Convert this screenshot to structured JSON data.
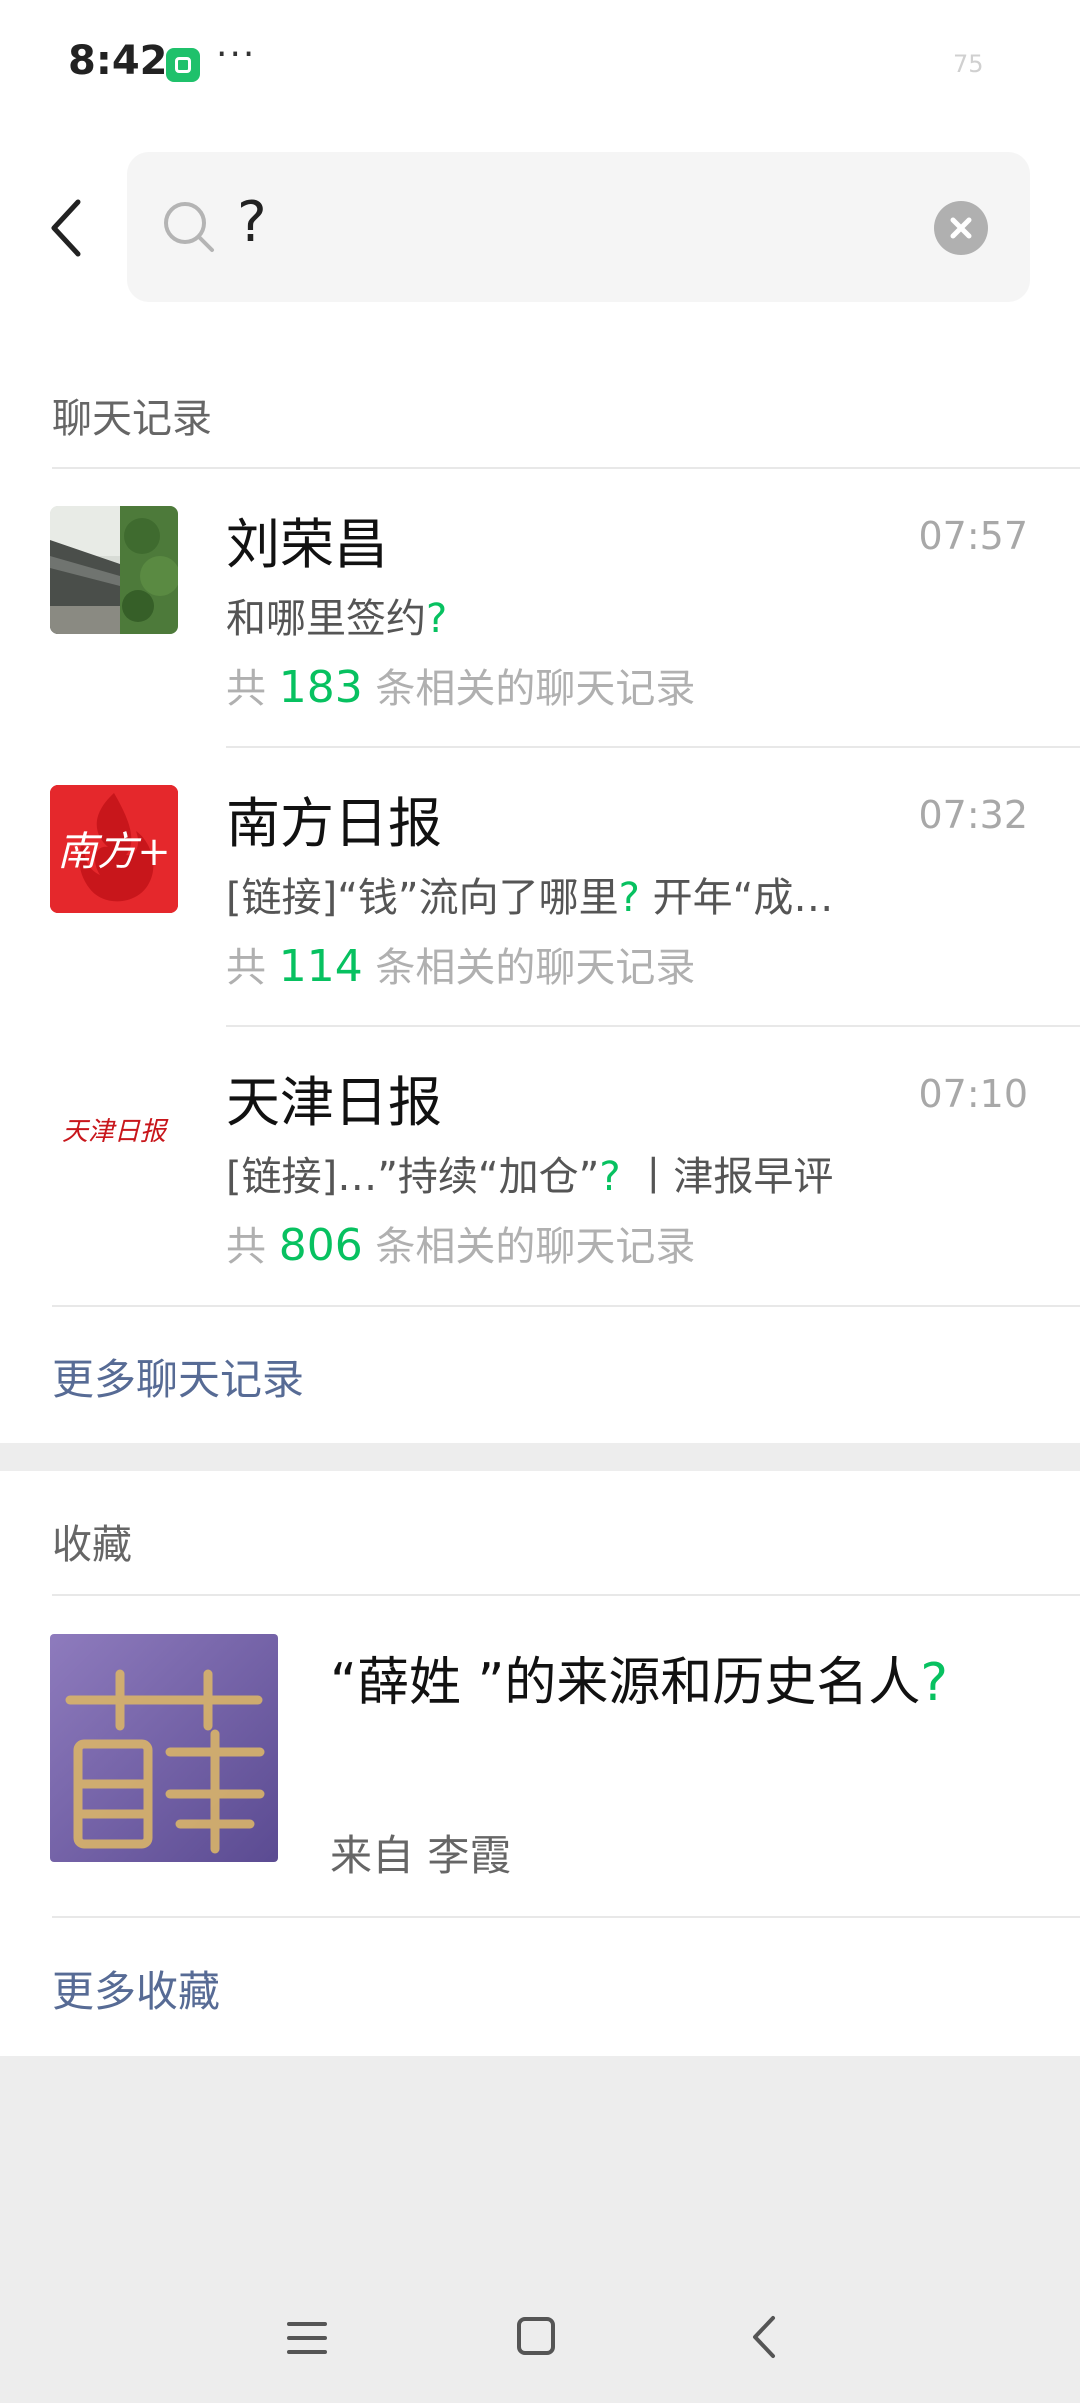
{
  "status_bar": {
    "time": "8:42",
    "dots": "···",
    "battery": "75",
    "app_icon": "app-notification-icon"
  },
  "search": {
    "query": "?",
    "icons": {
      "back": "back-arrow-icon",
      "search": "search-icon",
      "clear": "clear-icon"
    }
  },
  "chat_section": {
    "title": "聊天记录",
    "items": [
      {
        "name": "刘荣昌",
        "time": "07:57",
        "snippet_prefix": "和哪里签约",
        "snippet_match": "?",
        "snippet_suffix": "",
        "count_prefix": "共 ",
        "count": "183",
        "count_suffix": " 条相关的聊天记录",
        "avatar": "photo-avatar"
      },
      {
        "name": "南方日报",
        "time": "07:32",
        "snippet_prefix": "[链接]“钱”流向了哪里",
        "snippet_match": "?",
        "snippet_suffix": " 开年“成…",
        "count_prefix": "共 ",
        "count": "114",
        "count_suffix": " 条相关的聊天记录",
        "avatar": "nanfang-logo",
        "avatar_text": "南方+"
      },
      {
        "name": "天津日报",
        "time": "07:10",
        "snippet_prefix": "[链接]…”持续“加仓”",
        "snippet_match": "?",
        "snippet_suffix": " 丨津报早评",
        "count_prefix": "共 ",
        "count": "806",
        "count_suffix": " 条相关的聊天记录",
        "avatar": "tianjin-logo",
        "avatar_text": "天津日报"
      }
    ],
    "more": "更多聊天记录"
  },
  "favorites_section": {
    "title": "收藏",
    "item": {
      "title_prefix": "“薛姓 ”的来源和历史名人",
      "title_match": "?",
      "source": "来自 李霞",
      "thumb": "xue-character-thumbnail"
    },
    "more": "更多收藏"
  },
  "nav": {
    "icons": [
      "menu-icon",
      "home-icon",
      "back-icon"
    ]
  },
  "colors": {
    "accent_green": "#07c160",
    "link_blue": "#576b95",
    "nanfang_red": "#e5282c"
  }
}
